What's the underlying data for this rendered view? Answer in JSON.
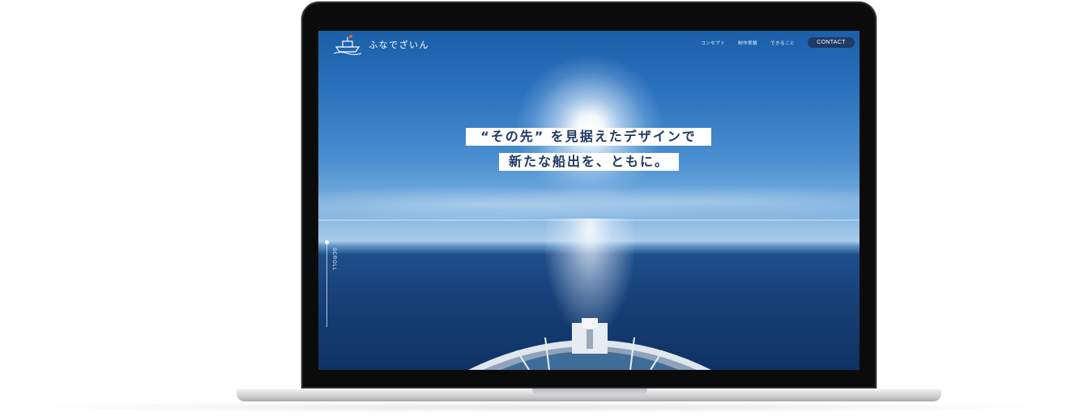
{
  "site": {
    "logo_text": "ふなでざいん",
    "nav": [
      {
        "label": "コンセプト"
      },
      {
        "label": "制作実績"
      },
      {
        "label": "できること"
      }
    ],
    "contact_label": "CONTACT"
  },
  "hero": {
    "line1": "“その先” を見据えたデザインで",
    "line2": "新たな船出を、ともに。"
  },
  "scroll": {
    "label": "SCROLL"
  },
  "colors": {
    "brand_navy": "#1f3a63",
    "sky_blue": "#2b72bd",
    "sea_blue": "#174178"
  },
  "icons": [
    "ship-logo-icon",
    "ship-bow-illustration"
  ]
}
